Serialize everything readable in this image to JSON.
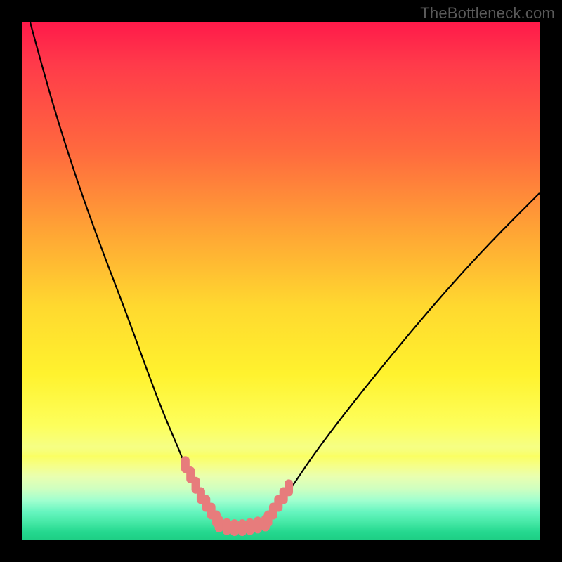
{
  "watermark": "TheBottleneck.com",
  "chart_data": {
    "type": "line",
    "title": "",
    "xlabel": "",
    "ylabel": "",
    "xlim": [
      0,
      100
    ],
    "ylim": [
      0,
      100
    ],
    "background_gradient": {
      "stops": [
        {
          "pos": 0,
          "color": "#ff1a4a"
        },
        {
          "pos": 25,
          "color": "#ff6a3e"
        },
        {
          "pos": 55,
          "color": "#ffd92f"
        },
        {
          "pos": 78,
          "color": "#fdff5c"
        },
        {
          "pos": 90,
          "color": "#c8ffb8"
        },
        {
          "pos": 100,
          "color": "#20d088"
        }
      ]
    },
    "series": [
      {
        "name": "left-curve",
        "color": "#000000",
        "x": [
          1.5,
          5,
          10,
          15,
          20,
          24,
          27,
          30,
          32,
          33.5,
          35,
          36.5,
          38
        ],
        "y": [
          100,
          87,
          71,
          57,
          44,
          33,
          25,
          18,
          13,
          10,
          7.5,
          5.5,
          3.5
        ]
      },
      {
        "name": "right-curve",
        "color": "#000000",
        "x": [
          47,
          49,
          52,
          56,
          62,
          70,
          80,
          90,
          100
        ],
        "y": [
          3.5,
          6,
          10,
          16,
          24,
          34,
          46,
          57,
          67
        ]
      },
      {
        "name": "left-markers",
        "color": "#E77C7C",
        "x": [
          31.5,
          32.5,
          33.5,
          34.5,
          35.5,
          36.5,
          37.5
        ],
        "y": [
          14.5,
          12.5,
          10.5,
          8.5,
          7,
          5.5,
          4
        ]
      },
      {
        "name": "valley-markers",
        "color": "#E77C7C",
        "x": [
          38,
          39.5,
          41,
          42.5,
          44,
          45.5,
          47
        ],
        "y": [
          3,
          2.5,
          2.3,
          2.3,
          2.5,
          2.8,
          3.2
        ]
      },
      {
        "name": "right-markers",
        "color": "#E77C7C",
        "x": [
          47.5,
          48.5,
          49.5,
          50.5,
          51.5
        ],
        "y": [
          4,
          5.5,
          7,
          8.5,
          10
        ]
      }
    ]
  }
}
